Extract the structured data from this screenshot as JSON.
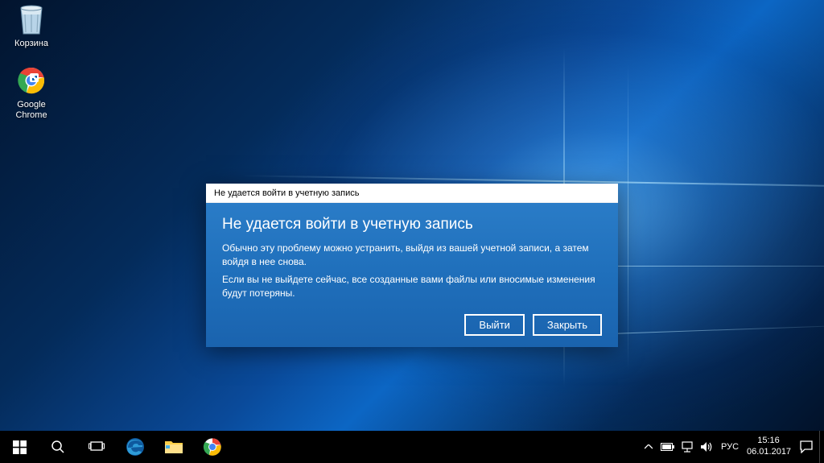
{
  "desktop": {
    "icons": {
      "recycle_bin": {
        "label": "Корзина"
      },
      "chrome": {
        "label": "Google Chrome"
      }
    }
  },
  "dialog": {
    "titlebar": "Не удается войти в учетную запись",
    "heading": "Не удается войти в учетную запись",
    "body1": "Обычно эту проблему можно устранить, выйдя из вашей учетной записи, а затем войдя в нее снова.",
    "body2": "Если вы не выйдете сейчас, все созданные вами файлы или вносимые изменения будут потеряны.",
    "buttons": {
      "signout": "Выйти",
      "close": "Закрыть"
    }
  },
  "taskbar": {
    "tray": {
      "language": "РУС",
      "time": "15:16",
      "date": "06.01.2017"
    }
  }
}
